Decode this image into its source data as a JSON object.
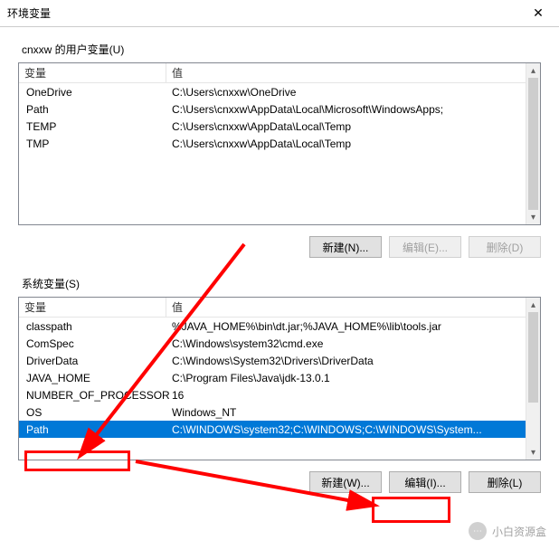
{
  "window": {
    "title": "环境变量",
    "close_glyph": "✕"
  },
  "user_section": {
    "label": "cnxxw 的用户变量(U)",
    "header": {
      "var": "变量",
      "val": "值"
    },
    "rows": [
      {
        "name": "OneDrive",
        "value": "C:\\Users\\cnxxw\\OneDrive"
      },
      {
        "name": "Path",
        "value": "C:\\Users\\cnxxw\\AppData\\Local\\Microsoft\\WindowsApps;"
      },
      {
        "name": "TEMP",
        "value": "C:\\Users\\cnxxw\\AppData\\Local\\Temp"
      },
      {
        "name": "TMP",
        "value": "C:\\Users\\cnxxw\\AppData\\Local\\Temp"
      }
    ],
    "buttons": {
      "new": "新建(N)...",
      "edit": "编辑(E)...",
      "delete": "删除(D)"
    }
  },
  "sys_section": {
    "label": "系统变量(S)",
    "header": {
      "var": "变量",
      "val": "值"
    },
    "rows": [
      {
        "name": "classpath",
        "value": "%JAVA_HOME%\\bin\\dt.jar;%JAVA_HOME%\\lib\\tools.jar"
      },
      {
        "name": "ComSpec",
        "value": "C:\\Windows\\system32\\cmd.exe"
      },
      {
        "name": "DriverData",
        "value": "C:\\Windows\\System32\\Drivers\\DriverData"
      },
      {
        "name": "JAVA_HOME",
        "value": "C:\\Program Files\\Java\\jdk-13.0.1"
      },
      {
        "name": "NUMBER_OF_PROCESSORS",
        "value": "16"
      },
      {
        "name": "OS",
        "value": "Windows_NT"
      },
      {
        "name": "Path",
        "value": "C:\\WINDOWS\\system32;C:\\WINDOWS;C:\\WINDOWS\\System..."
      }
    ],
    "selected_index": 6,
    "buttons": {
      "new": "新建(W)...",
      "edit": "编辑(I)...",
      "delete": "删除(L)"
    }
  },
  "scroll_glyphs": {
    "up": "▴",
    "down": "▾"
  },
  "watermark": {
    "text": "小白资源盒"
  }
}
